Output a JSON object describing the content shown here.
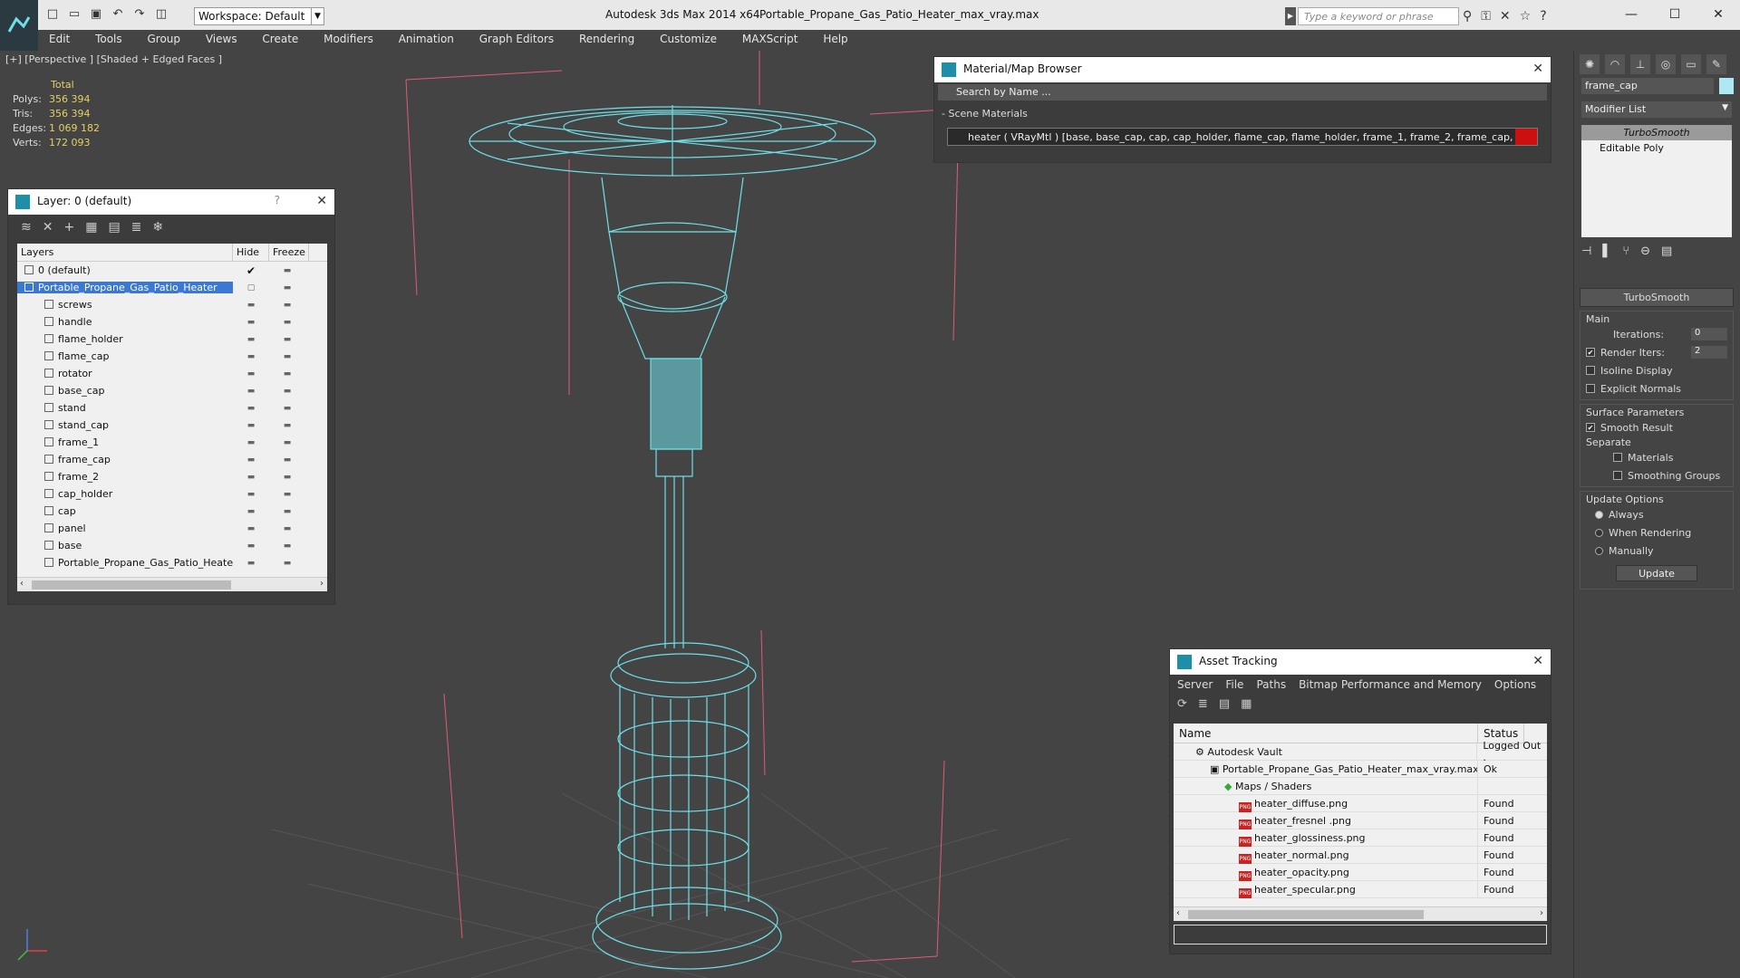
{
  "window": {
    "app_title": "Autodesk 3ds Max  2014 x64",
    "file_title": "Portable_Propane_Gas_Patio_Heater_max_vray.max",
    "workspace": "Workspace: Default",
    "search_placeholder": "Type a keyword or phrase"
  },
  "menu": [
    "Edit",
    "Tools",
    "Group",
    "Views",
    "Create",
    "Modifiers",
    "Animation",
    "Graph Editors",
    "Rendering",
    "Customize",
    "MAXScript",
    "Help"
  ],
  "viewport": {
    "label": "[+] [Perspective ] [Shaded + Edged Faces ]",
    "stats_header": "Total",
    "stats": [
      {
        "label": "Polys:",
        "value": "356 394"
      },
      {
        "label": "Tris:",
        "value": "356 394"
      },
      {
        "label": "Edges:",
        "value": "1 069 182"
      },
      {
        "label": "Verts:",
        "value": "172 093"
      }
    ]
  },
  "layer_panel": {
    "title": "Layer: 0 (default)",
    "help": "?",
    "columns": [
      "Layers",
      "Hide",
      "Freeze"
    ],
    "rows": [
      "0 (default)",
      "Portable_Propane_Gas_Patio_Heater",
      "screws",
      "handle",
      "flame_holder",
      "flame_cap",
      "rotator",
      "base_cap",
      "stand",
      "stand_cap",
      "frame_1",
      "frame_cap",
      "frame_2",
      "cap_holder",
      "cap",
      "panel",
      "base",
      "Portable_Propane_Gas_Patio_Heater"
    ]
  },
  "material_browser": {
    "title": "Material/Map Browser",
    "search_placeholder": "Search by Name ...",
    "section": "- Scene Materials",
    "material_row": "heater  ( VRayMtl )  [base, base_cap, cap, cap_holder, flame_cap, flame_holder, frame_1, frame_2, frame_cap, handle, p..."
  },
  "asset_tracking": {
    "title": "Asset Tracking",
    "menu": [
      "Server",
      "File",
      "Paths",
      "Bitmap Performance and Memory",
      "Options"
    ],
    "columns": [
      "Name",
      "Status"
    ],
    "rows": [
      {
        "name": "Autodesk Vault",
        "status": "Logged Out ."
      },
      {
        "name": "Portable_Propane_Gas_Patio_Heater_max_vray.max",
        "status": "Ok"
      },
      {
        "name": "Maps / Shaders",
        "status": ""
      },
      {
        "name": "heater_diffuse.png",
        "status": "Found"
      },
      {
        "name": "heater_fresnel .png",
        "status": "Found"
      },
      {
        "name": "heater_glossiness.png",
        "status": "Found"
      },
      {
        "name": "heater_normal.png",
        "status": "Found"
      },
      {
        "name": "heater_opacity.png",
        "status": "Found"
      },
      {
        "name": "heater_specular.png",
        "status": "Found"
      }
    ]
  },
  "command_panel": {
    "object_name": "frame_cap",
    "modifier_list": "Modifier List",
    "stack": [
      "TurboSmooth",
      "Editable Poly"
    ],
    "rollout_title": "TurboSmooth",
    "main_label": "Main",
    "iterations_label": "Iterations:",
    "iterations_value": "0",
    "render_iters_label": "Render Iters:",
    "render_iters_value": "2",
    "isoline": "Isoline Display",
    "explicit_normals": "Explicit Normals",
    "surface_params": "Surface Parameters",
    "smooth_result": "Smooth Result",
    "separate": "Separate",
    "materials": "Materials",
    "smoothing_groups": "Smoothing Groups",
    "update_options": "Update Options",
    "always": "Always",
    "when_rendering": "When Rendering",
    "manually": "Manually",
    "update_button": "Update"
  },
  "colors": {
    "wire": "#6ee0e8",
    "viewport_bg": "#444444",
    "selection": "#3a78d4",
    "bbox": "#e05a78"
  }
}
